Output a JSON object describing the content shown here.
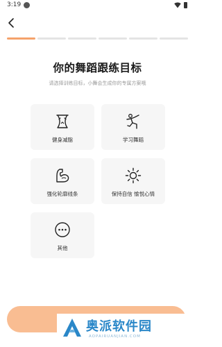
{
  "status_bar": {
    "time": "3:19"
  },
  "progress": {
    "total_steps": 6,
    "current_step": 1
  },
  "header": {
    "title": "你的舞蹈跟练目标",
    "subtitle": "请选择训练目标，小舞会生成你的专属方案哦"
  },
  "options": [
    {
      "label": "健身减脂",
      "icon": "waist-icon"
    },
    {
      "label": "学习舞蹈",
      "icon": "dancer-icon"
    },
    {
      "label": "强化轮廓线条",
      "icon": "muscle-arm-icon"
    },
    {
      "label": "保持自信 愉悦心情",
      "icon": "sun-icon"
    },
    {
      "label": "其他",
      "icon": "more-icon"
    }
  ],
  "next_button": {
    "label": ""
  },
  "watermark": {
    "text": "奥派软件园",
    "url": "AOPAIRUANJIAN.COM"
  },
  "colors": {
    "accent": "#f5a26b",
    "button": "#f9bd92",
    "card": "#f6f6f6",
    "watermark": "#2a87c8"
  }
}
